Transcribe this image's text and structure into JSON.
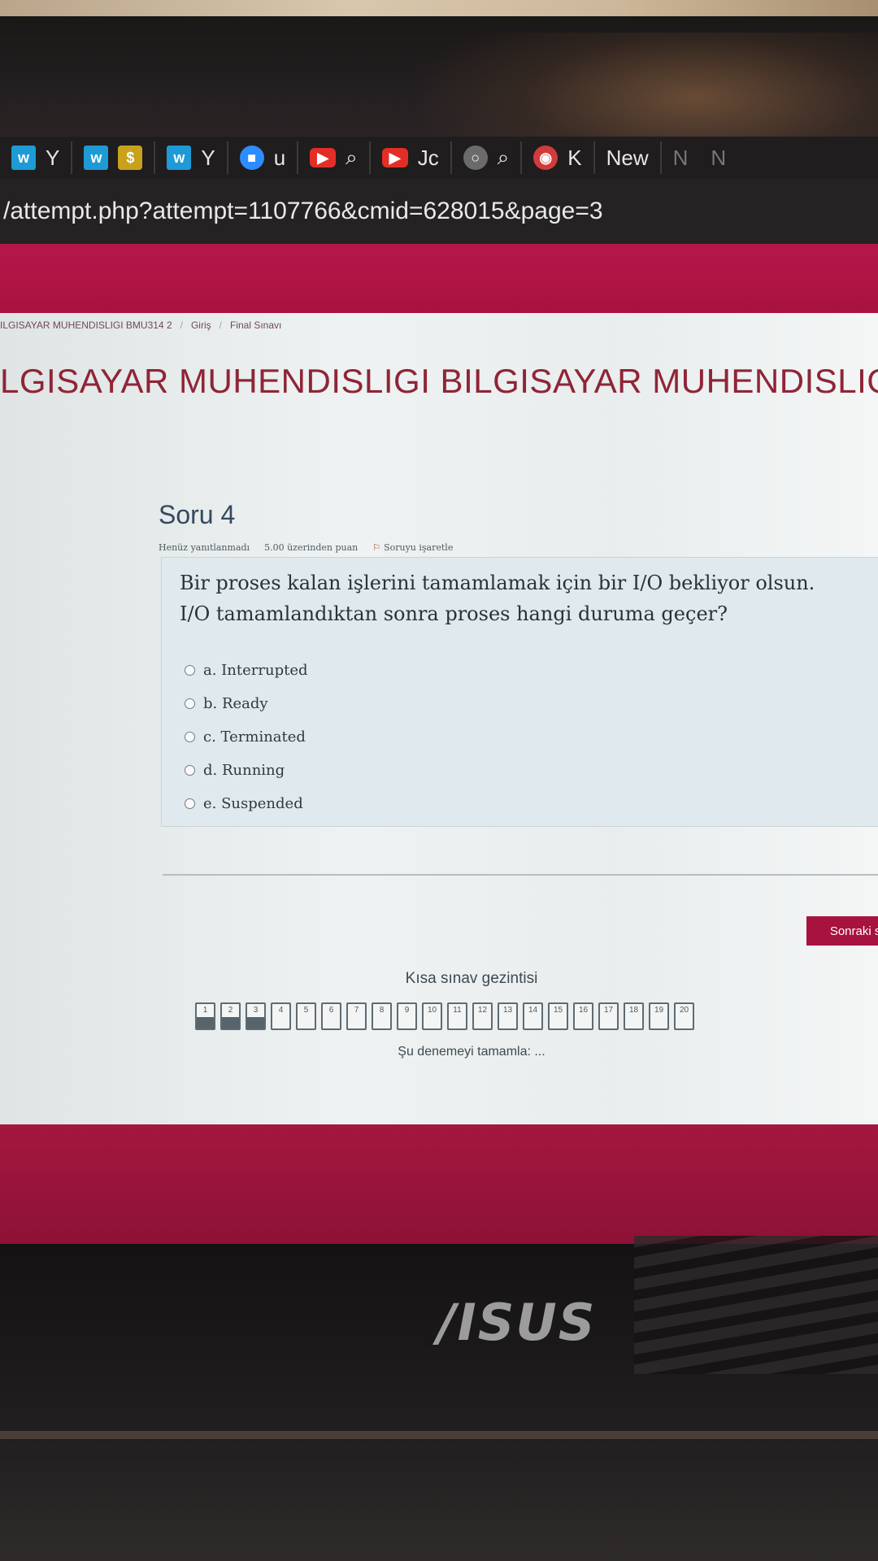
{
  "browser": {
    "tabs": [
      {
        "icon": "w-logo-icon",
        "label": "Y"
      },
      {
        "icon": "w-logo-icon",
        "label": ""
      },
      {
        "icon": "coin-icon",
        "label": ""
      },
      {
        "icon": "w-logo-icon",
        "label": "Y"
      },
      {
        "icon": "zoom-icon",
        "label": "u"
      },
      {
        "icon": "youtube-icon",
        "label": "⌕"
      },
      {
        "icon": "youtube-icon",
        "label": "Jc"
      },
      {
        "icon": "globe-icon",
        "label": "⌕"
      },
      {
        "icon": "record-icon",
        "label": "K"
      },
      {
        "icon": "",
        "label": "New"
      },
      {
        "icon": "",
        "label": "N"
      },
      {
        "icon": "",
        "label": "N"
      }
    ],
    "url": "/attempt.php?attempt=1107766&cmid=628015&page=3"
  },
  "breadcrumb": {
    "course": "ILGISAYAR MUHENDISLIGI BMU314 2",
    "section": "Giriş",
    "page": "Final Sınavı"
  },
  "course_title": "LGISAYAR MUHENDISLIGI BILGISAYAR MUHENDISLIGI",
  "question": {
    "title": "Soru 4",
    "status": "Henüz yanıtlanmadı",
    "points": "5.00 üzerinden puan",
    "flag_label": "Soruyu işaretle",
    "text": "Bir proses kalan işlerini tamamlamak için bir I/O bekliyor olsun. I/O tamamlandıktan sonra proses hangi duruma geçer?",
    "options": [
      "a. Interrupted",
      "b. Ready",
      "c. Terminated",
      "d. Running",
      "e. Suspended"
    ]
  },
  "next_button": "Sonraki say",
  "quiz_nav": {
    "title": "Kısa sınav gezintisi",
    "pages": [
      "1",
      "2",
      "3",
      "4",
      "5",
      "6",
      "7",
      "8",
      "9",
      "10",
      "11",
      "12",
      "13",
      "14",
      "15",
      "16",
      "17",
      "18",
      "19",
      "20"
    ],
    "answered": [
      1,
      2,
      3
    ],
    "finish_label": "Şu denemeyi tamamla: ..."
  },
  "laptop_brand": "/ISUS"
}
